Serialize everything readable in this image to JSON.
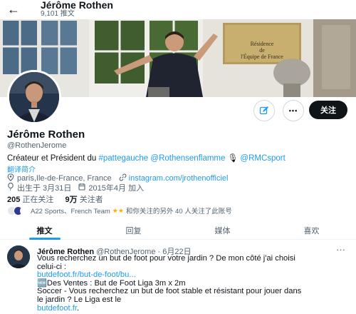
{
  "header": {
    "back_icon": "arrow-left-icon",
    "name": "Jérôme Rothen",
    "post_count": "9,101 推文"
  },
  "banner": {
    "plaque_line1": "Résidence",
    "plaque_line2": "de",
    "plaque_line3": "l'Équipe de France"
  },
  "actions": {
    "edit_icon": "edit-message-icon",
    "more_icon": "more-icon",
    "more_label": "•••",
    "follow_label": "关注"
  },
  "profile": {
    "name": "Jérôme Rothen",
    "handle": "@RothenJerome",
    "bio_prefix": "Créateur et Président du ",
    "bio_tag1": "#pattegauche",
    "bio_sep1": " ",
    "bio_tag2": "@Rothensenflamme",
    "bio_sep2": " 🎙 ",
    "bio_tag3": "@RMCsport",
    "translate": "翻译简介",
    "location": "paris,Ile-de-France, France",
    "website": "instagram.com/jrothenofficiel",
    "birth": "出生于 3月31日",
    "joined": "2015年4月 加入",
    "following_count": "205",
    "following_label": " 正在关注",
    "followers_count": "9万",
    "followers_label": " 关注者",
    "followed_by": "A22 Sports、French Team",
    "followed_by_suffix": "和你关注的另外 40 人关注了此账号"
  },
  "tabs": [
    {
      "label": "推文"
    },
    {
      "label": "回复"
    },
    {
      "label": "媒体"
    },
    {
      "label": "喜欢"
    }
  ],
  "tweet": {
    "name": "Jérôme Rothen",
    "handle": "@RothenJerome · 6月22日",
    "more": "···",
    "line1": "Vous recherchez un but de foot pour votre jardin ? De mon côté j'ai choisi",
    "line2": "celui-ci :",
    "line3": "butdefoot.fr/but-de-foot/bu...",
    "line4": "🆕Des Ventes : But de Foot Liga 3m x 2m",
    "line5": "Soccer - Vous recherchez un but de foot stable et résistant pour jouer dans",
    "line6": "le jardin ? Le Liga est le",
    "line7": "butdefoot.fr",
    "line7_suffix": "."
  },
  "colors": {
    "accent": "#1d9bf0",
    "text": "#0f1419",
    "muted": "#536471"
  }
}
